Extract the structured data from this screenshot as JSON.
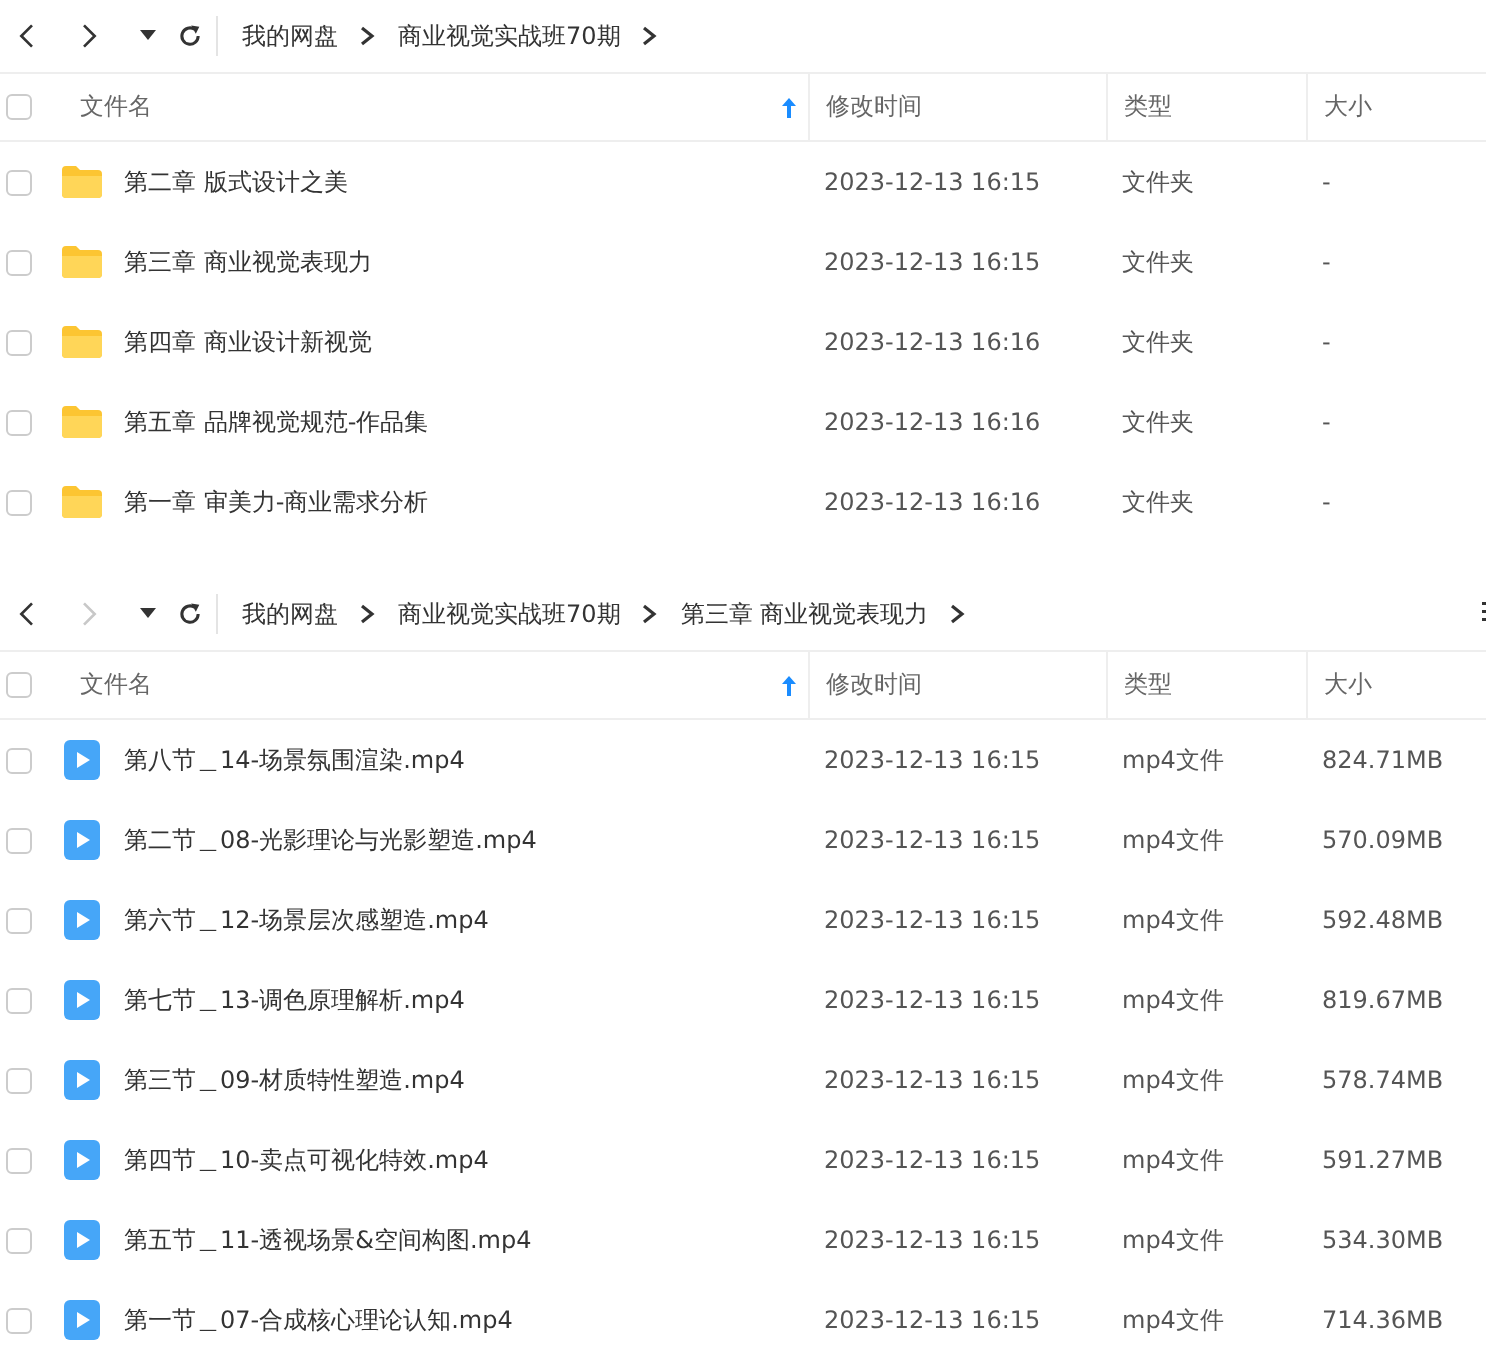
{
  "panels": [
    {
      "nav": {
        "back_disabled": false,
        "forward_disabled": false
      },
      "breadcrumbs": [
        "我的网盘",
        "商业视觉实战班70期"
      ],
      "more_menu": false,
      "columns": [
        {
          "label": "文件名",
          "sorted": true
        },
        {
          "label": "修改时间",
          "sorted": false
        },
        {
          "label": "类型",
          "sorted": false
        },
        {
          "label": "大小",
          "sorted": false
        }
      ],
      "select_all_checked": false,
      "rows": [
        {
          "kind": "folder",
          "name": "第二章 版式设计之美",
          "modified": "2023-12-13 16:15",
          "type": "文件夹",
          "size": "-",
          "checked": false
        },
        {
          "kind": "folder",
          "name": "第三章 商业视觉表现力",
          "modified": "2023-12-13 16:15",
          "type": "文件夹",
          "size": "-",
          "checked": false
        },
        {
          "kind": "folder",
          "name": "第四章 商业设计新视觉",
          "modified": "2023-12-13 16:16",
          "type": "文件夹",
          "size": "-",
          "checked": false
        },
        {
          "kind": "folder",
          "name": "第五章 品牌视觉规范-作品集",
          "modified": "2023-12-13 16:16",
          "type": "文件夹",
          "size": "-",
          "checked": false
        },
        {
          "kind": "folder",
          "name": "第一章 审美力-商业需求分析",
          "modified": "2023-12-13 16:16",
          "type": "文件夹",
          "size": "-",
          "checked": false
        }
      ]
    },
    {
      "nav": {
        "back_disabled": false,
        "forward_disabled": true
      },
      "breadcrumbs": [
        "我的网盘",
        "商业视觉实战班70期",
        "第三章 商业视觉表现力"
      ],
      "more_menu": true,
      "columns": [
        {
          "label": "文件名",
          "sorted": true
        },
        {
          "label": "修改时间",
          "sorted": false
        },
        {
          "label": "类型",
          "sorted": false
        },
        {
          "label": "大小",
          "sorted": false
        }
      ],
      "select_all_checked": false,
      "rows": [
        {
          "kind": "video",
          "name": "第八节＿14-场景氛围渲染.mp4",
          "modified": "2023-12-13 16:15",
          "type": "mp4文件",
          "size": "824.71MB",
          "checked": false
        },
        {
          "kind": "video",
          "name": "第二节＿08-光影理论与光影塑造.mp4",
          "modified": "2023-12-13 16:15",
          "type": "mp4文件",
          "size": "570.09MB",
          "checked": false
        },
        {
          "kind": "video",
          "name": "第六节＿12-场景层次感塑造.mp4",
          "modified": "2023-12-13 16:15",
          "type": "mp4文件",
          "size": "592.48MB",
          "checked": false
        },
        {
          "kind": "video",
          "name": "第七节＿13-调色原理解析.mp4",
          "modified": "2023-12-13 16:15",
          "type": "mp4文件",
          "size": "819.67MB",
          "checked": false
        },
        {
          "kind": "video",
          "name": "第三节＿09-材质特性塑造.mp4",
          "modified": "2023-12-13 16:15",
          "type": "mp4文件",
          "size": "578.74MB",
          "checked": false
        },
        {
          "kind": "video",
          "name": "第四节＿10-卖点可视化特效.mp4",
          "modified": "2023-12-13 16:15",
          "type": "mp4文件",
          "size": "591.27MB",
          "checked": false
        },
        {
          "kind": "video",
          "name": "第五节＿11-透视场景&空间构图.mp4",
          "modified": "2023-12-13 16:15",
          "type": "mp4文件",
          "size": "534.30MB",
          "checked": false
        },
        {
          "kind": "video",
          "name": "第一节＿07-合成核心理论认知.mp4",
          "modified": "2023-12-13 16:15",
          "type": "mp4文件",
          "size": "714.36MB",
          "checked": false
        }
      ]
    }
  ]
}
